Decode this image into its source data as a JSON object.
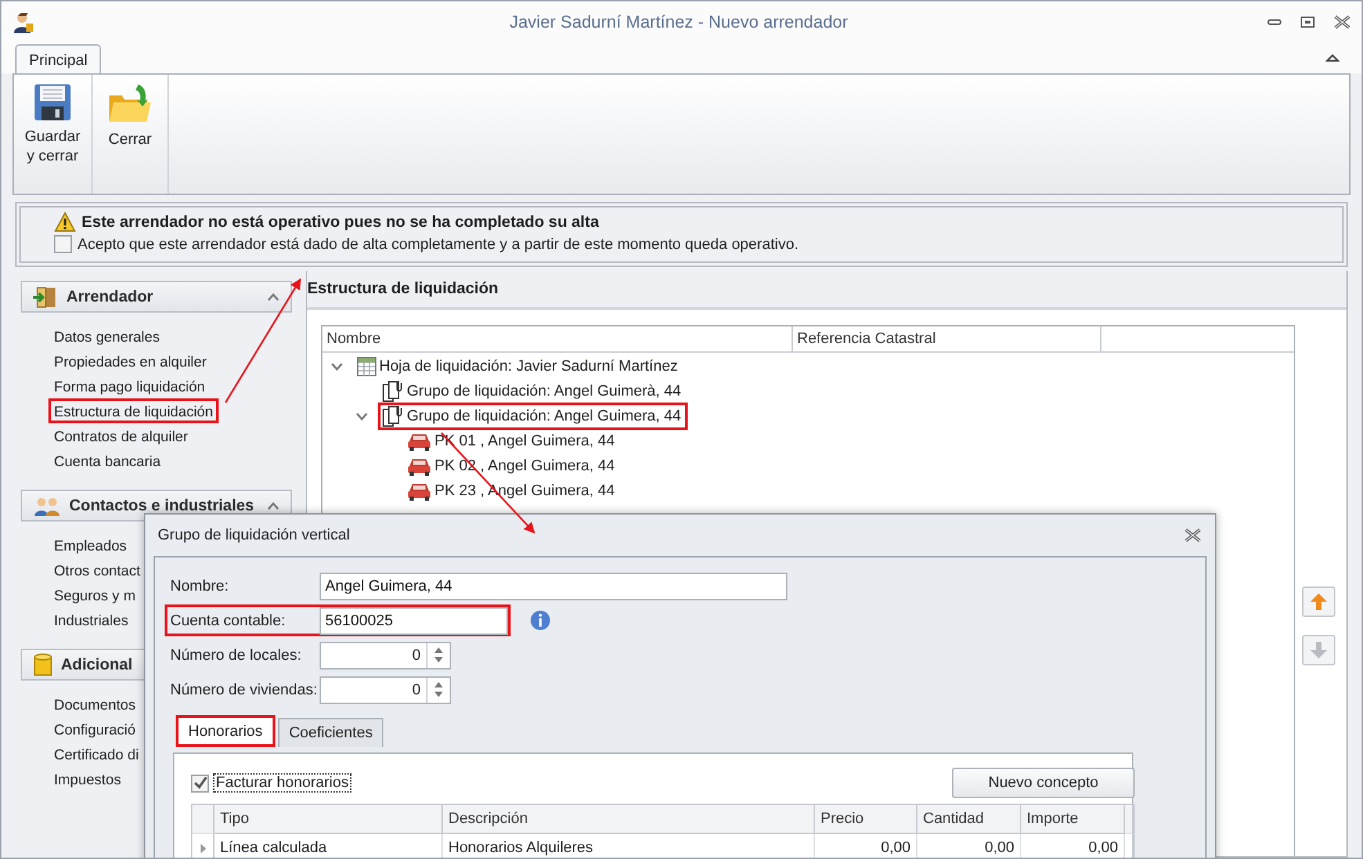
{
  "window": {
    "title": "Javier Sadurní Martínez - Nuevo arrendador"
  },
  "ribbon": {
    "tabs": [
      {
        "label": "Principal",
        "selected": true
      }
    ],
    "buttons": [
      {
        "label": "Guardar\ny cerrar",
        "kind": "save"
      },
      {
        "label": "Cerrar",
        "kind": "close"
      }
    ]
  },
  "notice": {
    "message": "Este arrendador no está operativo pues no se ha completado su alta",
    "confirm": {
      "label": "Acepto que este arrendador está dado de alta completamente y a partir de este momento queda operativo.",
      "checked": false
    }
  },
  "sidebar": {
    "groups": [
      {
        "title": "Arrendador",
        "kind": "door",
        "expanded": true,
        "items": [
          {
            "label": "Datos generales",
            "annotated": false
          },
          {
            "label": "Propiedades en alquiler",
            "annotated": false
          },
          {
            "label": "Forma pago liquidación",
            "annotated": false
          },
          {
            "label": "Estructura de liquidación",
            "annotated": true
          },
          {
            "label": "Contratos de alquiler",
            "annotated": false
          },
          {
            "label": "Cuenta bancaria",
            "annotated": false
          }
        ]
      },
      {
        "title": "Contactos e industriales",
        "kind": "people",
        "expanded": true,
        "items": [
          {
            "label": "Empleados",
            "annotated": false
          },
          {
            "label": "Otros contact",
            "annotated": false
          },
          {
            "label": "Seguros y m",
            "annotated": false
          },
          {
            "label": "Industriales",
            "annotated": false
          }
        ]
      },
      {
        "title": "Adicional",
        "kind": "database",
        "items": [
          {
            "label": "Documentos",
            "annotated": false
          },
          {
            "label": "Configuració",
            "annotated": false
          },
          {
            "label": "Certificado di",
            "annotated": false
          },
          {
            "label": "Impuestos",
            "annotated": false
          }
        ]
      }
    ]
  },
  "content": {
    "title": "Estructura de liquidación",
    "tree": {
      "columns": [
        "Nombre",
        "Referencia Catastral"
      ],
      "nodes": [
        {
          "label": "Hoja de liquidación: Javier Sadurní Martínez",
          "kind": "sheet",
          "expanded": true,
          "annotated": false,
          "children": [
            {
              "label": "Grupo de liquidación: Angel Guimerà, 44",
              "kind": "group",
              "annotated": false
            },
            {
              "label": "Grupo de liquidación: Angel Guimera, 44",
              "kind": "group",
              "expanded": true,
              "annotated": true,
              "children": [
                {
                  "label": "PK 01 , Angel Guimera, 44",
                  "kind": "car",
                  "annotated": false
                },
                {
                  "label": "PK 02 , Angel Guimera, 44",
                  "kind": "car",
                  "annotated": false
                },
                {
                  "label": "PK 23 , Angel Guimera, 44",
                  "kind": "car",
                  "annotated": false
                }
              ]
            }
          ]
        }
      ]
    },
    "move_buttons": [
      {
        "kind": "up",
        "disabled": false
      },
      {
        "kind": "down",
        "disabled": true
      }
    ]
  },
  "dialog": {
    "title": "Grupo de liquidación vertical",
    "fields": [
      {
        "label": "Nombre:",
        "value": "Angel Guimera, 44",
        "kind": "text",
        "annotated": false
      },
      {
        "label": "Cuenta contable:",
        "value": "56100025",
        "kind": "text",
        "annotated": true,
        "info": true
      },
      {
        "label": "Número de locales:",
        "value": "0",
        "kind": "spin",
        "annotated": false
      },
      {
        "label": "Número de viviendas:",
        "value": "0",
        "kind": "spin",
        "annotated": false
      }
    ],
    "tabs": [
      {
        "label": "Honorarios",
        "selected": true,
        "annotated": true
      },
      {
        "label": "Coeficientes",
        "selected": false,
        "annotated": false
      }
    ],
    "invoice_fees": {
      "label": "Facturar honorarios",
      "checked": true
    },
    "new_button": "Nuevo concepto",
    "grid": {
      "columns": [
        "Tipo",
        "Descripción",
        "Precio",
        "Cantidad",
        "Importe"
      ],
      "rows": [
        {
          "cells": [
            "Línea calculada",
            "Honorarios Alquileres",
            "0,00",
            "0,00",
            "0,00"
          ]
        }
      ]
    }
  }
}
